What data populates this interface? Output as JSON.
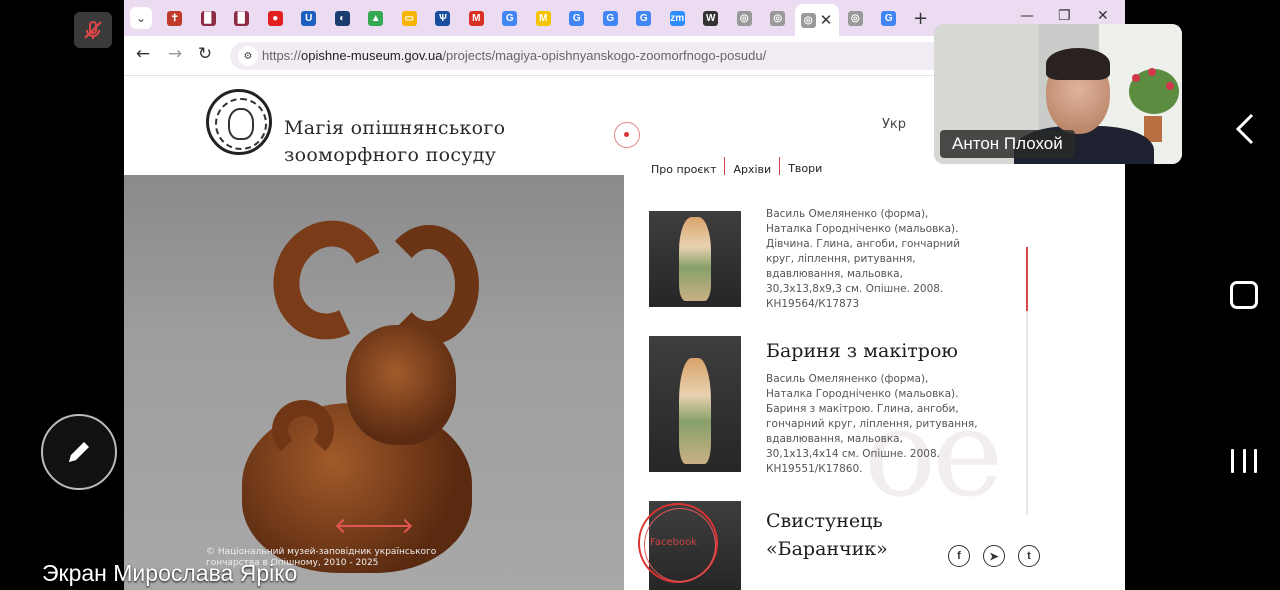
{
  "meeting": {
    "screen_share_label": "Экран Мирослава Ярiко",
    "participant_name": "Антон Плохой"
  },
  "browser": {
    "tabs": [
      {
        "icon": "cross-icon",
        "glyph": "✝",
        "color": "#c0392b"
      },
      {
        "icon": "book-icon",
        "glyph": "▉",
        "color": "#8e2c48"
      },
      {
        "icon": "book-icon",
        "glyph": "▉",
        "color": "#8e2c48"
      },
      {
        "icon": "japan-flag-icon",
        "glyph": "●",
        "color": "#e02020"
      },
      {
        "icon": "ukr-icon",
        "glyph": "U",
        "color": "#1b5fbf"
      },
      {
        "icon": "half-moon-icon",
        "glyph": "◐",
        "color": "#1a3c6e"
      },
      {
        "icon": "drive-icon",
        "glyph": "▲",
        "color": "#34a853"
      },
      {
        "icon": "slides-icon",
        "glyph": "▭",
        "color": "#f4b400"
      },
      {
        "icon": "ua-crest-icon",
        "glyph": "Ѱ",
        "color": "#1a4fa0"
      },
      {
        "icon": "gmail-icon",
        "glyph": "M",
        "color": "#d93025"
      },
      {
        "icon": "google-icon",
        "glyph": "G",
        "color": "#4285f4"
      },
      {
        "icon": "miro-icon",
        "glyph": "M",
        "color": "#f5c400"
      },
      {
        "icon": "google-icon",
        "glyph": "G",
        "color": "#4285f4"
      },
      {
        "icon": "google-icon",
        "glyph": "G",
        "color": "#4285f4"
      },
      {
        "icon": "google-icon",
        "glyph": "G",
        "color": "#4285f4"
      },
      {
        "icon": "zoom-icon",
        "glyph": "zm",
        "color": "#2d8cff"
      },
      {
        "icon": "wikipedia-icon",
        "glyph": "W",
        "color": "#333333"
      },
      {
        "icon": "page-icon",
        "glyph": "◎",
        "color": "#999999"
      },
      {
        "icon": "page-icon",
        "glyph": "◎",
        "color": "#999999"
      },
      {
        "icon": "page-icon",
        "glyph": "◎",
        "color": "#999999",
        "active": true
      },
      {
        "icon": "page-icon",
        "glyph": "◎",
        "color": "#999999"
      },
      {
        "icon": "google-icon",
        "glyph": "G",
        "color": "#4285f4"
      }
    ],
    "url_domain": "opishne-museum.gov.ua",
    "url_path": "/projects/magiya-opishnyanskogo-zoomorfnogo-posudu/",
    "url_scheme": "https://"
  },
  "site": {
    "title_line1": "Магія опішнянського",
    "title_line2": "зооморфного посуду",
    "lang": "Укр",
    "menu": [
      "Про проєкт",
      "Архіви",
      "Твори"
    ],
    "copyright": "© Національний музей-заповідник українського гончарства в Опішному, 2010 - 2025",
    "watermark": "ое"
  },
  "works": [
    {
      "title": "",
      "desc": "Василь Омеляненко (форма), Наталка Городніченко (мальовка). Дівчина. Глина, ангоби, гончарний круг, ліплення, ритування, вдавлювання, мальовка, 30,3х13,8х9,3 см. Опішне. 2008. КН19564/К17873"
    },
    {
      "title": "Бариня з макітрою",
      "desc": "Василь Омеляненко (форма), Наталка Городніченко (мальовка). Бариня з макітрою. Глина, ангоби, гончарний круг, ліплення, ритування, вдавлювання, мальовка, 30,1х13,4х14 см. Опішне. 2008. КН19551/К17860."
    },
    {
      "title": "Свистунець «Баранчик»",
      "desc": ""
    }
  ],
  "facebook_label": "Facebook",
  "social": [
    {
      "name": "facebook",
      "glyph": "f"
    },
    {
      "name": "telegram",
      "glyph": "➤"
    },
    {
      "name": "twitter",
      "glyph": "t"
    }
  ],
  "colors": {
    "accent_red": "#d64545",
    "tabbar": "#ecdcf1"
  }
}
